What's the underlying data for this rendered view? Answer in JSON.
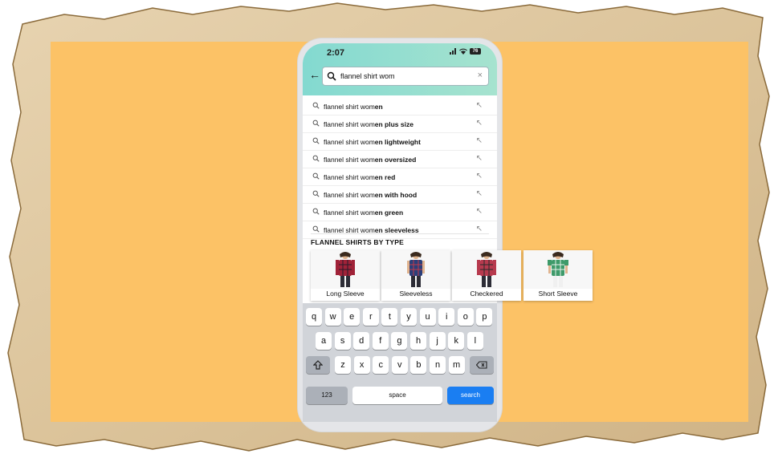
{
  "status_bar": {
    "time": "2:07",
    "battery": "76"
  },
  "search": {
    "query": "flannel shirt wom"
  },
  "suggestions": [
    {
      "prefix": "flannel shirt wom",
      "bold": "en"
    },
    {
      "prefix": "flannel shirt wom",
      "bold": "en plus size"
    },
    {
      "prefix": "flannel shirt wom",
      "bold": "en lightweight"
    },
    {
      "prefix": "flannel shirt wom",
      "bold": "en oversized"
    },
    {
      "prefix": "flannel shirt wom",
      "bold": "en red"
    },
    {
      "prefix": "flannel shirt wom",
      "bold": "en with hood"
    },
    {
      "prefix": "flannel shirt wom",
      "bold": "en green"
    },
    {
      "prefix": "flannel shirt wom",
      "bold": "en sleeveless"
    }
  ],
  "section_title": "FLANNEL SHIRTS BY TYPE",
  "types": [
    {
      "label": "Long Sleeve"
    },
    {
      "label": "Sleeveless"
    },
    {
      "label": "Checkered"
    },
    {
      "label": "Short Sleeve"
    }
  ],
  "keyboard": {
    "row1": [
      "q",
      "w",
      "e",
      "r",
      "t",
      "y",
      "u",
      "i",
      "o",
      "p"
    ],
    "row2": [
      "a",
      "s",
      "d",
      "f",
      "g",
      "h",
      "j",
      "k",
      "l"
    ],
    "row3": [
      "z",
      "x",
      "c",
      "v",
      "b",
      "n",
      "m"
    ],
    "numbers_label": "123",
    "space_label": "space",
    "search_label": "search"
  },
  "colors": {
    "frame_background": "#fcc266",
    "accent_teal": "#83d9d0",
    "search_key": "#1a7ef2"
  }
}
